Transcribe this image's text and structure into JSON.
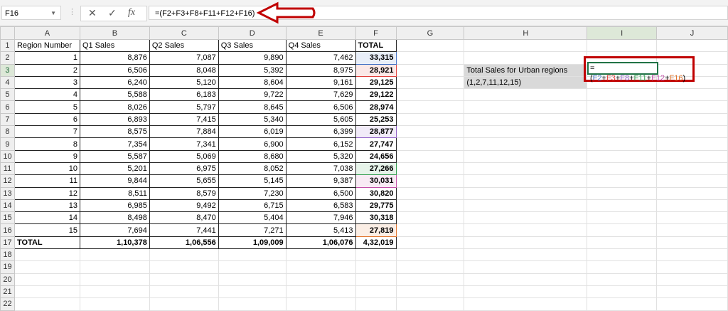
{
  "namebox": "F16",
  "formula": "=(F2+F3+F8+F11+F12+F16)",
  "columns": [
    "A",
    "B",
    "C",
    "D",
    "E",
    "F",
    "G",
    "H",
    "I",
    "J"
  ],
  "headers": [
    "Region Number",
    "Q1 Sales",
    "Q2 Sales",
    "Q3 Sales",
    "Q4 Sales",
    "TOTAL"
  ],
  "rows": [
    [
      "1",
      "8,876",
      "7,087",
      "9,890",
      "7,462",
      "33,315"
    ],
    [
      "2",
      "6,506",
      "8,048",
      "5,392",
      "8,975",
      "28,921"
    ],
    [
      "3",
      "6,240",
      "5,120",
      "8,604",
      "9,161",
      "29,125"
    ],
    [
      "4",
      "5,588",
      "6,183",
      "9,722",
      "7,629",
      "29,122"
    ],
    [
      "5",
      "8,026",
      "5,797",
      "8,645",
      "6,506",
      "28,974"
    ],
    [
      "6",
      "6,893",
      "7,415",
      "5,340",
      "5,605",
      "25,253"
    ],
    [
      "7",
      "8,575",
      "7,884",
      "6,019",
      "6,399",
      "28,877"
    ],
    [
      "8",
      "7,354",
      "7,341",
      "6,900",
      "6,152",
      "27,747"
    ],
    [
      "9",
      "5,587",
      "5,069",
      "8,680",
      "5,320",
      "24,656"
    ],
    [
      "10",
      "5,201",
      "6,975",
      "8,052",
      "7,038",
      "27,266"
    ],
    [
      "11",
      "9,844",
      "5,655",
      "5,145",
      "9,387",
      "30,031"
    ],
    [
      "12",
      "8,511",
      "8,579",
      "7,230",
      "6,500",
      "30,820"
    ],
    [
      "13",
      "6,985",
      "9,492",
      "6,715",
      "6,583",
      "29,775"
    ],
    [
      "14",
      "8,498",
      "8,470",
      "5,404",
      "7,946",
      "30,318"
    ],
    [
      "15",
      "7,694",
      "7,441",
      "7,271",
      "5,413",
      "27,819"
    ]
  ],
  "totals": [
    "TOTAL",
    "1,10,378",
    "1,06,556",
    "1,09,009",
    "1,06,076",
    "4,32,019"
  ],
  "label_h3": "Total Sales for Urban regions",
  "label_h4": "(1,2,7,11,12,15)",
  "edit_parts": [
    {
      "t": "=(",
      "c": "#000000"
    },
    {
      "t": "F2",
      "c": "#4472c4"
    },
    {
      "t": "+",
      "c": "#000000"
    },
    {
      "t": "F3",
      "c": "#e0403c"
    },
    {
      "t": "+",
      "c": "#000000"
    },
    {
      "t": "F8",
      "c": "#8e5cc4"
    },
    {
      "t": "+",
      "c": "#000000"
    },
    {
      "t": "F11",
      "c": "#2e9a4a"
    },
    {
      "t": "+",
      "c": "#000000"
    },
    {
      "t": "F12",
      "c": "#c24fa8"
    },
    {
      "t": "+",
      "c": "#000000"
    },
    {
      "t": "F16",
      "c": "#e0742c"
    },
    {
      "t": ")",
      "c": "#000000"
    }
  ],
  "ref_colors": {
    "2": "#4472c4",
    "3": "#e0403c",
    "8": "#8e5cc4",
    "11": "#2e9a4a",
    "12": "#c24fa8",
    "16": "#e0742c"
  },
  "row_count": 22
}
